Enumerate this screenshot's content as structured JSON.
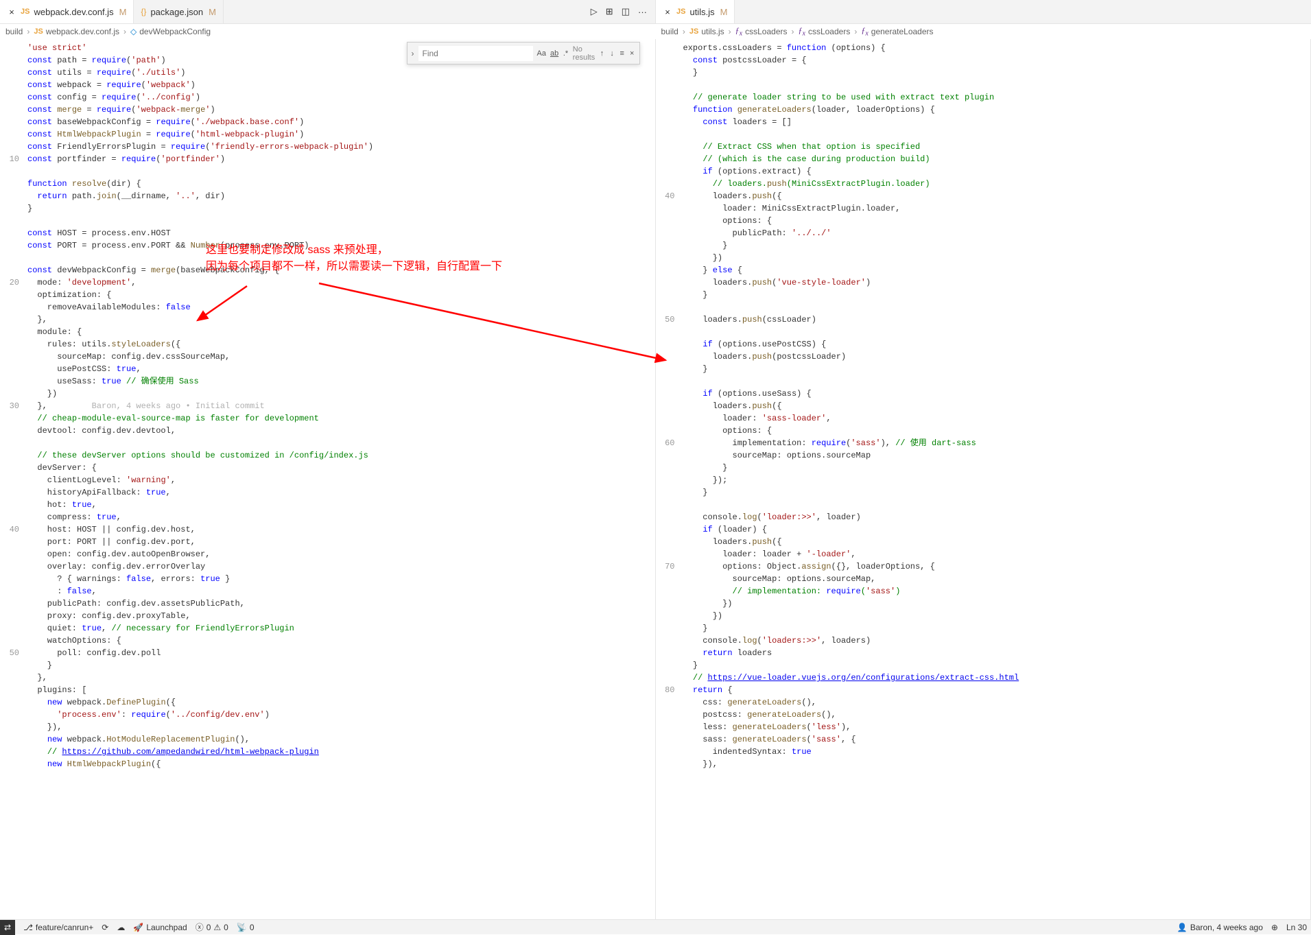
{
  "tabs": {
    "left": [
      {
        "name": "webpack.dev.conf.js",
        "modified": "M",
        "icon": "JS",
        "active": true
      },
      {
        "name": "package.json",
        "modified": "M",
        "icon": "{}",
        "active": false
      }
    ],
    "right": [
      {
        "name": "utils.js",
        "modified": "M",
        "icon": "JS",
        "active": true
      }
    ]
  },
  "tabActions": {
    "run": "▷",
    "compare": "⊞",
    "split": "◫",
    "more": "···"
  },
  "breadcrumbs": {
    "left": [
      "build",
      "webpack.dev.conf.js",
      "devWebpackConfig"
    ],
    "right": [
      "build",
      "utils.js",
      "cssLoaders",
      "cssLoaders",
      "generateLoaders"
    ]
  },
  "find": {
    "placeholder": "Find",
    "results": "No results",
    "opts": {
      "case": "Aa",
      "word": "ab",
      "regex": ".*"
    }
  },
  "annotation": {
    "line1": "这里也要制定修改成 sass 来预处理，",
    "line2": "因为每个项目都不一样，所以需要读一下逻辑，自行配置一下"
  },
  "gutterLeft": [
    "",
    "",
    "",
    "",
    "",
    "",
    "",
    "",
    "",
    "10",
    "",
    "",
    "",
    "",
    "",
    "",
    "",
    "",
    "",
    "20",
    "",
    "",
    "",
    "",
    "",
    "",
    "",
    "",
    "",
    "30",
    "",
    "",
    "",
    "",
    "",
    "",
    "",
    "",
    "",
    "40",
    "",
    "",
    "",
    "",
    "",
    "",
    "",
    "",
    "",
    "50",
    "",
    "",
    "",
    "",
    "",
    "",
    "",
    "",
    ""
  ],
  "gutterRight": [
    "",
    "",
    "",
    "",
    "",
    "",
    "",
    "",
    "",
    "",
    "",
    "",
    "40",
    "",
    "",
    "",
    "",
    "",
    "",
    "",
    "",
    "",
    "50",
    "",
    "",
    "",
    "",
    "",
    "",
    "",
    "",
    "",
    "60",
    "",
    "",
    "",
    "",
    "",
    "",
    "",
    "",
    "",
    "70",
    "",
    "",
    "",
    "",
    "",
    "",
    "",
    "",
    "",
    "80",
    "",
    "",
    "",
    "",
    "",
    "",
    ""
  ],
  "status": {
    "branch": "feature/canrun+",
    "errors": "0",
    "warnings": "0",
    "ports": "0",
    "launchpad": "Launchpad",
    "blame": "Baron, 4 weeks ago",
    "line": "Ln 30"
  },
  "code_left_text": "'use strict'\nconst path = require('path')\nconst utils = require('./utils')\nconst webpack = require('webpack')\nconst config = require('../config')\nconst merge = require('webpack-merge')\nconst baseWebpackConfig = require('./webpack.base.conf')\nconst HtmlWebpackPlugin = require('html-webpack-plugin')\nconst FriendlyErrorsPlugin = require('friendly-errors-webpack-plugin')\nconst portfinder = require('portfinder')\n\nfunction resolve(dir) {\n  return path.join(__dirname, '..', dir)\n}\n\nconst HOST = process.env.HOST\nconst PORT = process.env.PORT && Number(process.env.PORT)\n\nconst devWebpackConfig = merge(baseWebpackConfig, {\n  mode: 'development',\n  optimization: {\n    removeAvailableModules: false\n  },\n  module: {\n    rules: utils.styleLoaders({\n      sourceMap: config.dev.cssSourceMap,\n      usePostCSS: true,\n      useSass: true // 确保使用 Sass\n    })\n  },         Baron, 4 weeks ago • Initial commit\n  // cheap-module-eval-source-map is faster for development\n  devtool: config.dev.devtool,\n\n  // these devServer options should be customized in /config/index.js\n  devServer: {\n    clientLogLevel: 'warning',\n    historyApiFallback: true,\n    hot: true,\n    compress: true,\n    host: HOST || config.dev.host,\n    port: PORT || config.dev.port,\n    open: config.dev.autoOpenBrowser,\n    overlay: config.dev.errorOverlay\n      ? { warnings: false, errors: true }\n      : false,\n    publicPath: config.dev.assetsPublicPath,\n    proxy: config.dev.proxyTable,\n    quiet: true, // necessary for FriendlyErrorsPlugin\n    watchOptions: {\n      poll: config.dev.poll\n    }\n  },\n  plugins: [\n    new webpack.DefinePlugin({\n      'process.env': require('../config/dev.env')\n    }),\n    new webpack.HotModuleReplacementPlugin(),\n    // https://github.com/ampedandwired/html-webpack-plugin\n    new HtmlWebpackPlugin({",
  "code_right_text": "exports.cssLoaders = function (options) {\n  const postcssLoader = {\n  }\n\n  // generate loader string to be used with extract text plugin\n  function generateLoaders(loader, loaderOptions) {\n    const loaders = []\n\n    // Extract CSS when that option is specified\n    // (which is the case during production build)\n    if (options.extract) {\n      // loaders.push(MiniCssExtractPlugin.loader)\n      loaders.push({\n        loader: MiniCssExtractPlugin.loader,\n        options: {\n          publicPath: '../../'\n        }\n      })\n    } else {\n      loaders.push('vue-style-loader')\n    }\n\n    loaders.push(cssLoader)\n\n    if (options.usePostCSS) {\n      loaders.push(postcssLoader)\n    }\n\n    if (options.useSass) {\n      loaders.push({\n        loader: 'sass-loader',\n        options: {\n          implementation: require('sass'), // 使用 dart-sass\n          sourceMap: options.sourceMap\n        }\n      });\n    }\n\n    console.log('loader:>>', loader)\n    if (loader) {\n      loaders.push({\n        loader: loader + '-loader',\n        options: Object.assign({}, loaderOptions, {\n          sourceMap: options.sourceMap,\n          // implementation: require('sass')\n        })\n      })\n    }\n    console.log('loaders:>>', loaders)\n    return loaders\n  }\n  // https://vue-loader.vuejs.org/en/configurations/extract-css.html\n  return {\n    css: generateLoaders(),\n    postcss: generateLoaders(),\n    less: generateLoaders('less'),\n    sass: generateLoaders('sass', {\n      indentedSyntax: true\n    }),"
}
